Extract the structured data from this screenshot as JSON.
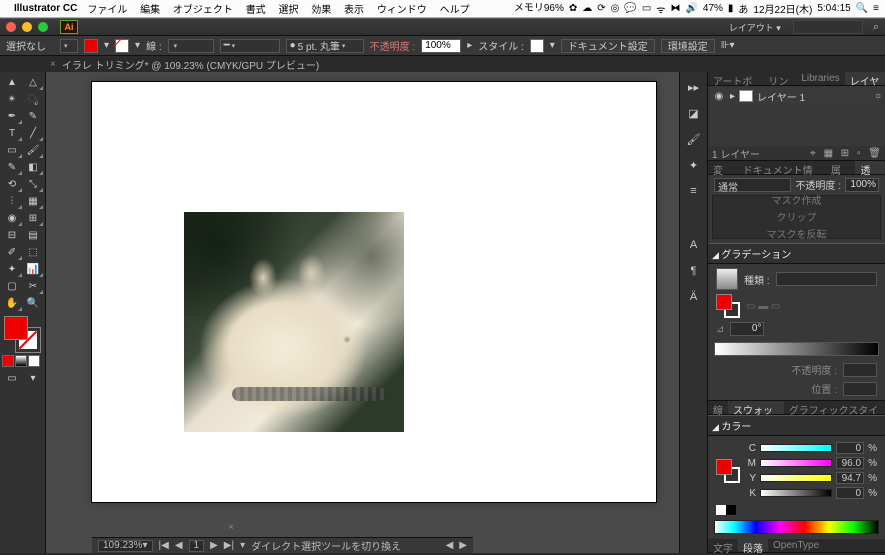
{
  "menubar": {
    "app": "Illustrator CC",
    "items": [
      "ファイル",
      "編集",
      "オブジェクト",
      "書式",
      "選択",
      "効果",
      "表示",
      "ウィンドウ",
      "ヘルプ"
    ],
    "mem_label": "メモリ",
    "mem_val": "96%",
    "battery": "47%",
    "date": "12月22日(木)",
    "time": "5:04:15"
  },
  "window": {
    "workspace_label": "レイアウト ▾"
  },
  "optbar": {
    "selection": "選択なし",
    "stroke_label": "線 :",
    "stroke_weight": "",
    "brush_size": "5 pt. 丸筆",
    "opacity_label": "不透明度 :",
    "opacity_val": "100%",
    "style_label": "スタイル :",
    "doc_setup": "ドキュメント設定",
    "prefs": "環境設定"
  },
  "doc_tab": "イラレ トリミング* @ 109.23% (CMYK/GPU プレビュー)",
  "status": {
    "zoom": "109.23%",
    "page": "1",
    "hint": "ダイレクト選択ツールを切り換え"
  },
  "layers_panel": {
    "tabs": [
      "アートボード",
      "リンク",
      "Libraries",
      "レイヤー"
    ],
    "layer_name": "レイヤー 1",
    "footer": "1 レイヤー"
  },
  "info_panel": {
    "tabs": [
      "変形",
      "ドキュメント情報",
      "属性",
      "透明"
    ]
  },
  "trans": {
    "blend": "通常",
    "opacity_label": "不透明度 :",
    "opacity_val": "100%",
    "make_mask": "マスク作成",
    "clip": "クリップ",
    "invert": "マスクを反転"
  },
  "grad_panel": {
    "title": "グラデーション",
    "type_label": "種類 :",
    "angle": "0°",
    "opacity_label": "不透明度 :",
    "pos_label": "位置 :"
  },
  "swatch_panel": {
    "tabs": [
      "線",
      "スウォッチ",
      "グラフィックスタイル"
    ]
  },
  "color_panel": {
    "title": "カラー",
    "c": "0",
    "m": "96.0",
    "y": "94.7",
    "k": "0",
    "pct": "%"
  },
  "bottom_tabs": [
    "文字",
    "段落",
    "OpenType"
  ]
}
